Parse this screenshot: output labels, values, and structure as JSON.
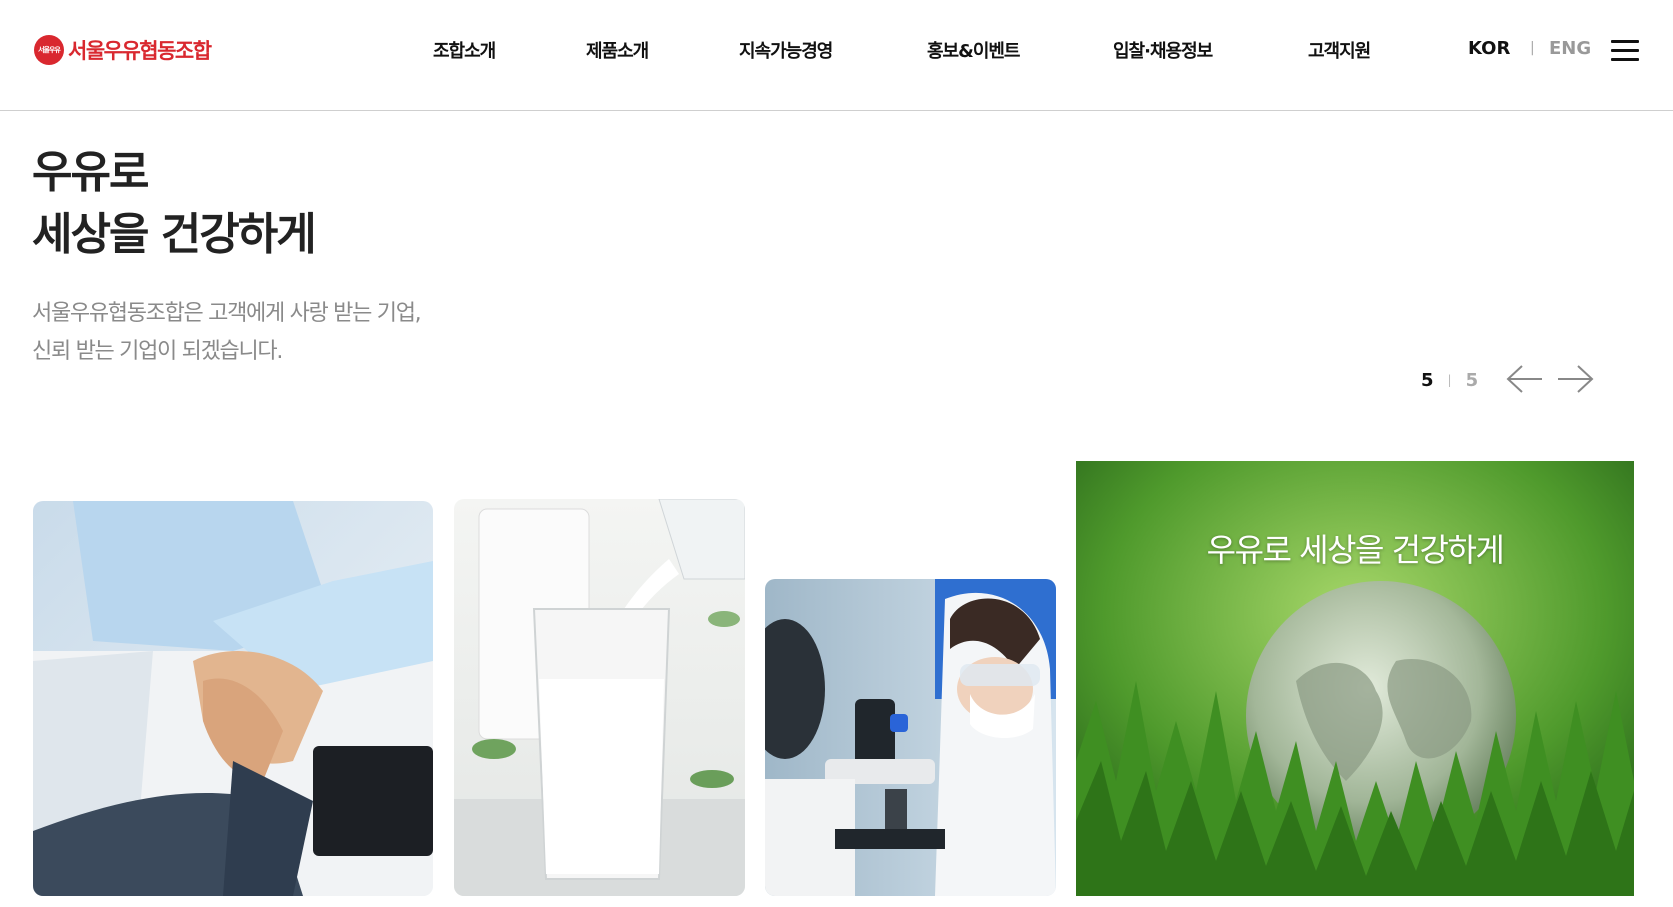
{
  "brand": {
    "name": "서울우유협동조합",
    "mark_text": "서울우유",
    "color": "#d9282f"
  },
  "nav": {
    "items": [
      {
        "label": "조합소개"
      },
      {
        "label": "제품소개"
      },
      {
        "label": "지속가능경영"
      },
      {
        "label": "홍보&이벤트"
      },
      {
        "label": "입찰·채용정보"
      },
      {
        "label": "고객지원"
      }
    ],
    "lang_kor": "KOR",
    "lang_sep": "|",
    "lang_eng": "ENG",
    "menu_icon": "hamburger-icon"
  },
  "hero": {
    "title_line1": "우유로",
    "title_line2": "세상을 건강하게",
    "desc_line1": "서울우유협동조합은 고객에게 사랑 받는 기업,",
    "desc_line2": "신뢰 받는 기업이 되겠습니다."
  },
  "pager": {
    "current": "5",
    "separator": "|",
    "total": "5",
    "prev_icon": "arrow-left-icon",
    "next_icon": "arrow-right-icon"
  },
  "cards": [
    {
      "image": "handshake-image"
    },
    {
      "image": "milk-glass-image"
    },
    {
      "image": "scientist-microscope-image"
    },
    {
      "image": "globe-grass-image",
      "caption": "우유로 세상을 건강하게"
    }
  ]
}
